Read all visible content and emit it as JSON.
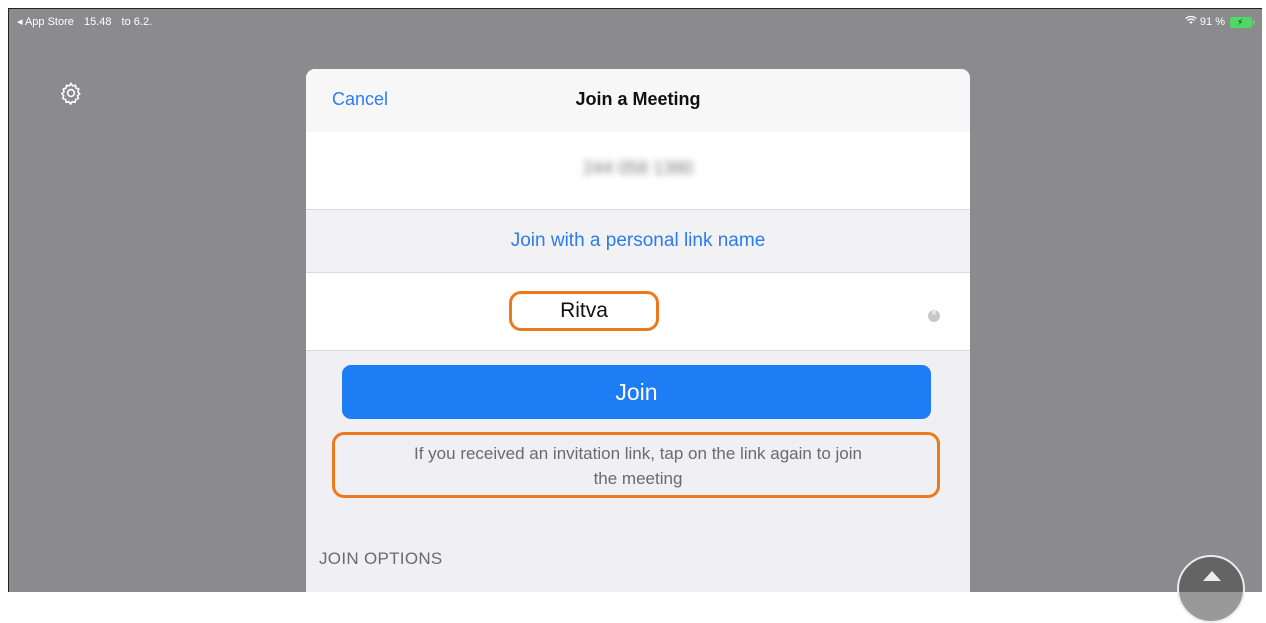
{
  "status_bar": {
    "back_app": "◂ App Store",
    "time": "15.48",
    "date": "to 6.2.",
    "battery_percent": "91 %",
    "wifi_icon": "wifi-icon",
    "battery_icon": "battery-charging-icon"
  },
  "background": {
    "settings_icon": "gear-icon"
  },
  "dialog": {
    "cancel_label": "Cancel",
    "title": "Join a Meeting",
    "meeting_id": "244 058 1380",
    "personal_link_label": "Join with a personal link name",
    "name_value": "Ritva",
    "clear_icon": "clear-circle-icon",
    "join_label": "Join",
    "hint_text": "If you received an invitation link, tap on the link again to join\nthe meeting",
    "join_options_header": "JOIN OPTIONS"
  },
  "colors": {
    "accent": "#1e7cf5",
    "link": "#2d7bf0",
    "highlight": "#ec7a1c",
    "backdrop": "#8b8b8d"
  }
}
